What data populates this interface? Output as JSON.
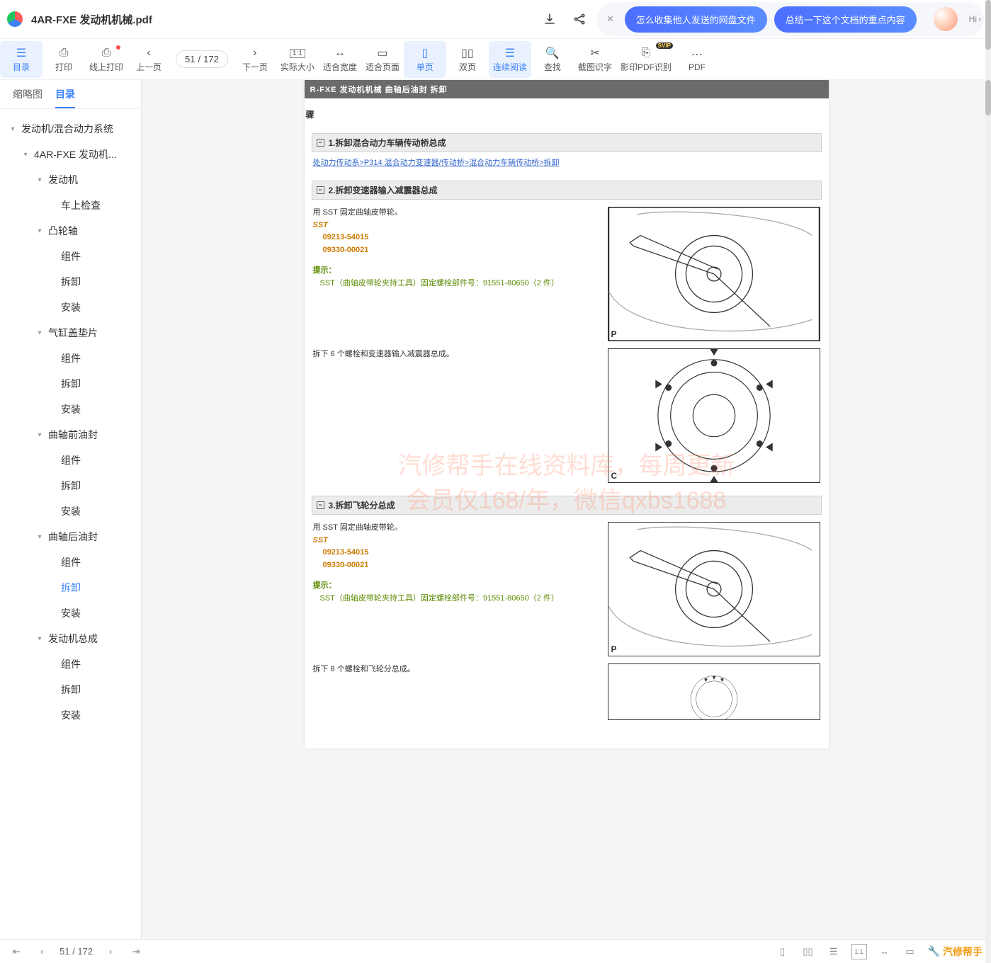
{
  "header": {
    "file_name": "4AR-FXE 发动机机械.pdf",
    "pill1": "怎么收集他人发送的网盘文件",
    "pill2": "总结一下这个文档的重点内容",
    "hi": "Hi"
  },
  "toolbar": {
    "catalog": "目录",
    "print": "打印",
    "online_print": "线上打印",
    "prev_page": "上一页",
    "page_current": "51",
    "page_sep": "/",
    "page_total": "172",
    "next_page": "下一页",
    "actual_size": "实际大小",
    "fit_width": "适合宽度",
    "fit_page": "适合页面",
    "single_page": "单页",
    "double_page": "双页",
    "continuous": "连续阅读",
    "find": "查找",
    "ocr_shot": "截图识字",
    "ocr_pdf": "影印PDF识别",
    "pdf_more": "PDF",
    "svip": "SVIP"
  },
  "side": {
    "tab_thumb": "缩略图",
    "tab_toc": "目录"
  },
  "tree": {
    "n0": "发动机/混合动力系统",
    "n1": "4AR-FXE 发动机...",
    "n2": "发动机",
    "n2a": "车上检查",
    "n3": "凸轮轴",
    "comp": "组件",
    "remove": "拆卸",
    "install": "安装",
    "n4": "气缸盖垫片",
    "n5": "曲轴前油封",
    "n6": "曲轴后油封",
    "n7": "发动机总成"
  },
  "doc": {
    "page_header": "R-FXE  发动机机械   曲轴后油封   拆卸",
    "step_mark": "骤",
    "sec1": "1.拆卸混合动力车辆传动桥总成",
    "crumb": "处动力传动系>P314 混合动力变速器/传动桥>混合动力车辆传动桥>拆卸",
    "sec2": "2.拆卸变速器输入减震器总成",
    "txt2a": "用 SST 固定曲轴皮带轮。",
    "sst": "SST",
    "sst1": "09213-54015",
    "sst2": "09330-00021",
    "hint": "提示：",
    "hint_txt": "SST（曲轴皮带轮夹持工具）固定螺栓部件号：91551-80650（2 件）",
    "txt2b": "拆下 6 个螺栓和变速器输入减震器总成。",
    "sec3": "3.拆卸飞轮分总成",
    "txt3a": "用 SST 固定曲轴皮带轮。",
    "txt3b": "拆下 8 个螺栓和飞轮分总成。",
    "wm1": "汽修帮手在线资料库，每周更新",
    "wm2": "会员仅168/年，微信qxbs1688",
    "fig_p": "P",
    "fig_c": "C"
  },
  "footer": {
    "page_current": "51",
    "page_sep": "/",
    "page_total": "172",
    "brand": "汽修帮手"
  }
}
